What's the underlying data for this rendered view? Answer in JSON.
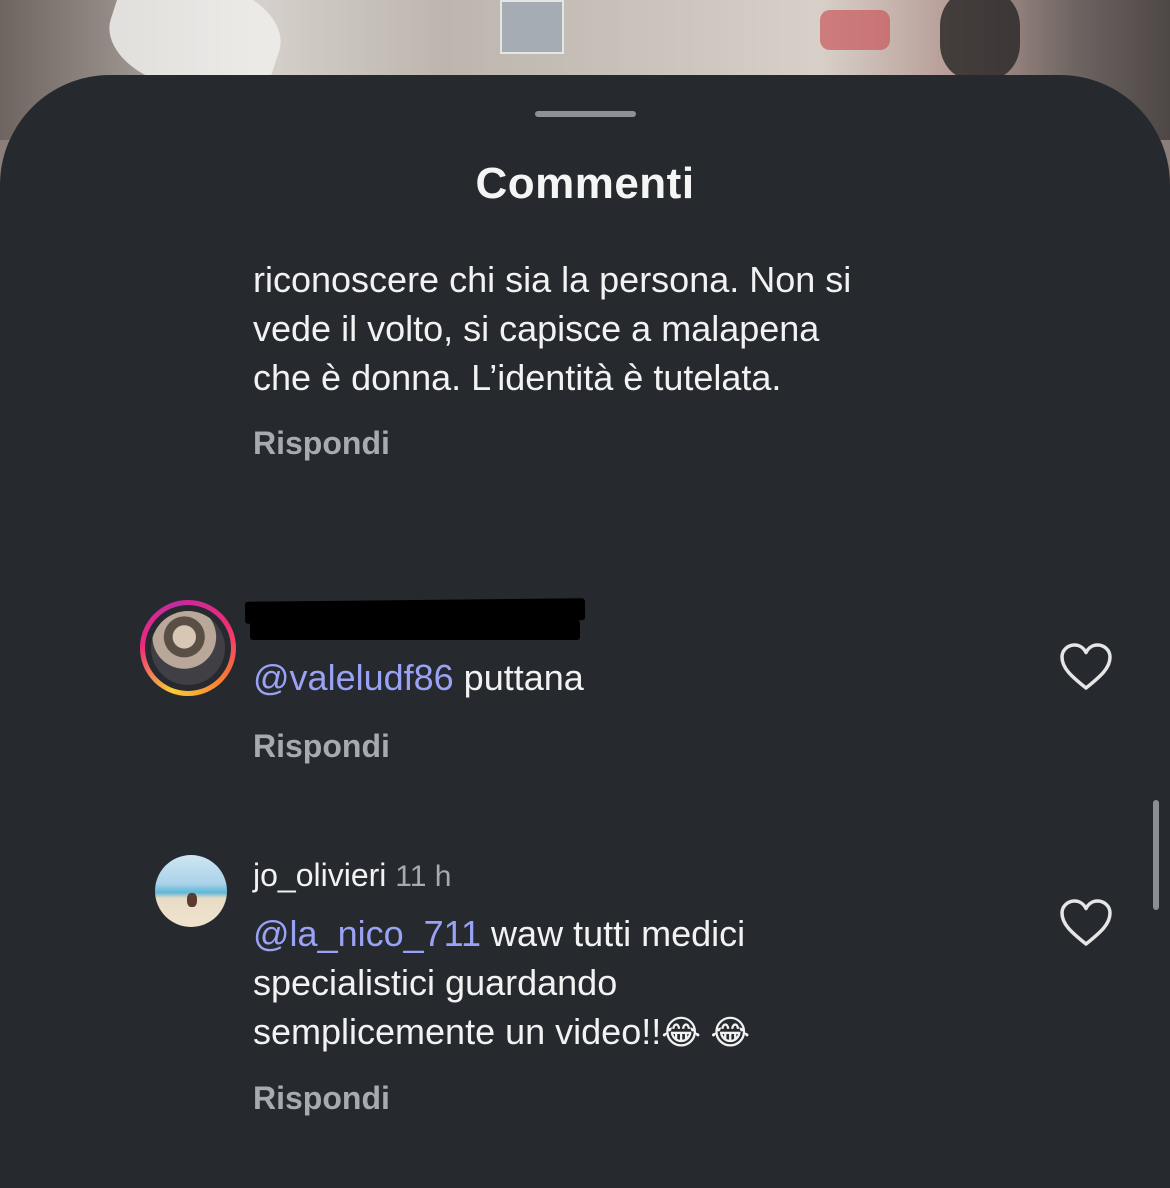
{
  "sheet": {
    "title": "Commenti"
  },
  "comments": [
    {
      "text_lines": [
        "riconoscere chi sia la persona. Non si",
        "vede il volto, si capisce a malapena",
        "che è donna. L’identità è tutelata."
      ],
      "reply_label": "Rispondi"
    },
    {
      "username": "",
      "username_redacted": true,
      "avatar_story_ring": true,
      "mention": "@valeludf86",
      "text": " puttana",
      "reply_label": "Rispondi",
      "like_icon": "heart-outline-icon"
    },
    {
      "username": "jo_olivieri",
      "time": "11 h",
      "mention": "@la_nico_711",
      "text_line1": " waw tutti medici",
      "text_line2": "specialistici guardando",
      "text_line3": "semplicemente un video!!",
      "emojis": "😂 😂",
      "reply_label": "Rispondi",
      "like_icon": "heart-outline-icon"
    }
  ],
  "colors": {
    "sheet_bg": "#262a2f",
    "mention": "#9aa2f5",
    "secondary_text": "#a7abb0",
    "primary_text": "#f2f2f2"
  }
}
